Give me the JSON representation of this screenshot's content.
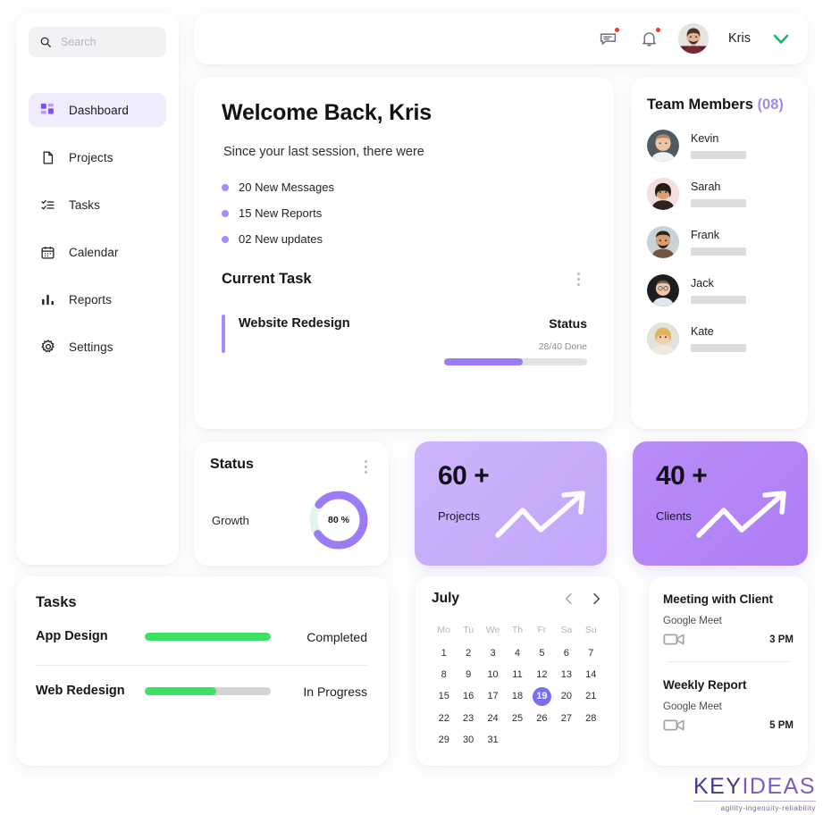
{
  "search": {
    "placeholder": "Search",
    "value": ""
  },
  "sidebar": {
    "items": [
      {
        "label": "Dashboard",
        "icon": "grid-icon",
        "active": true
      },
      {
        "label": "Projects",
        "icon": "document-icon",
        "active": false
      },
      {
        "label": "Tasks",
        "icon": "checklist-icon",
        "active": false
      },
      {
        "label": "Calendar",
        "icon": "calendar-icon",
        "active": false
      },
      {
        "label": "Reports",
        "icon": "bar-chart-icon",
        "active": false
      },
      {
        "label": "Settings",
        "icon": "gear-icon",
        "active": false
      }
    ]
  },
  "topbar": {
    "message_icon": "message-icon",
    "bell_icon": "bell-icon",
    "user_name": "Kris",
    "chevron_icon": "chevron-down-icon",
    "accent_green": "#18b86b"
  },
  "welcome": {
    "title": "Welcome Back, Kris",
    "subtitle": "Since your last session, there were",
    "stats": [
      "20 New Messages",
      "15 New Reports",
      "02 New updates"
    ],
    "current_task_heading": "Current Task",
    "task": {
      "name": "Website Redesign",
      "status_label": "Status",
      "done_text": "28/40 Done",
      "progress_percent": 55,
      "accent": "#a78bfa"
    }
  },
  "team": {
    "title": "Team Members",
    "count": "(08)",
    "members": [
      {
        "name": "Kevin"
      },
      {
        "name": "Sarah"
      },
      {
        "name": "Frank"
      },
      {
        "name": "Jack"
      },
      {
        "name": "Kate"
      }
    ]
  },
  "status_card": {
    "title": "Status",
    "label": "Growth",
    "percent_text": "80 %",
    "percent_value": 80,
    "ring_color": "#9c7cf4",
    "track_color": "#e4f5ec"
  },
  "kpis": [
    {
      "value": "60 +",
      "label": "Projects",
      "color": "#c9aefb"
    },
    {
      "value": "40 +",
      "label": "Clients",
      "color": "#b385f6"
    }
  ],
  "tasks_card": {
    "title": "Tasks",
    "items": [
      {
        "name": "App Design",
        "state": "Completed",
        "progress": 100
      },
      {
        "name": "Web Redesign",
        "state": "In Progress",
        "progress": 57
      }
    ],
    "bar_color": "#3ee064"
  },
  "calendar": {
    "month": "July",
    "prev_icon": "chevron-left-icon",
    "next_icon": "chevron-right-icon",
    "day_names": [
      "Mo",
      "Tu",
      "We",
      "Th",
      "Fr",
      "Sa",
      "Su"
    ],
    "lead_blanks": 0,
    "days": [
      1,
      2,
      3,
      4,
      5,
      6,
      7,
      8,
      9,
      10,
      11,
      12,
      13,
      14,
      15,
      16,
      17,
      18,
      19,
      20,
      21,
      22,
      23,
      24,
      25,
      26,
      27,
      28,
      29,
      30,
      31
    ],
    "selected_day": 19,
    "selected_color": "#7a6ef0"
  },
  "meetings": [
    {
      "title": "Meeting with Client",
      "platform": "Google Meet",
      "time": "3 PM",
      "icon": "video-camera-icon"
    },
    {
      "title": "Weekly Report",
      "platform": "Google Meet",
      "time": "5 PM",
      "icon": "video-camera-icon"
    }
  ],
  "logo": {
    "part1": "KEY",
    "part2": "IDEAS",
    "tagline": "agility-ingenuity-reliability"
  }
}
